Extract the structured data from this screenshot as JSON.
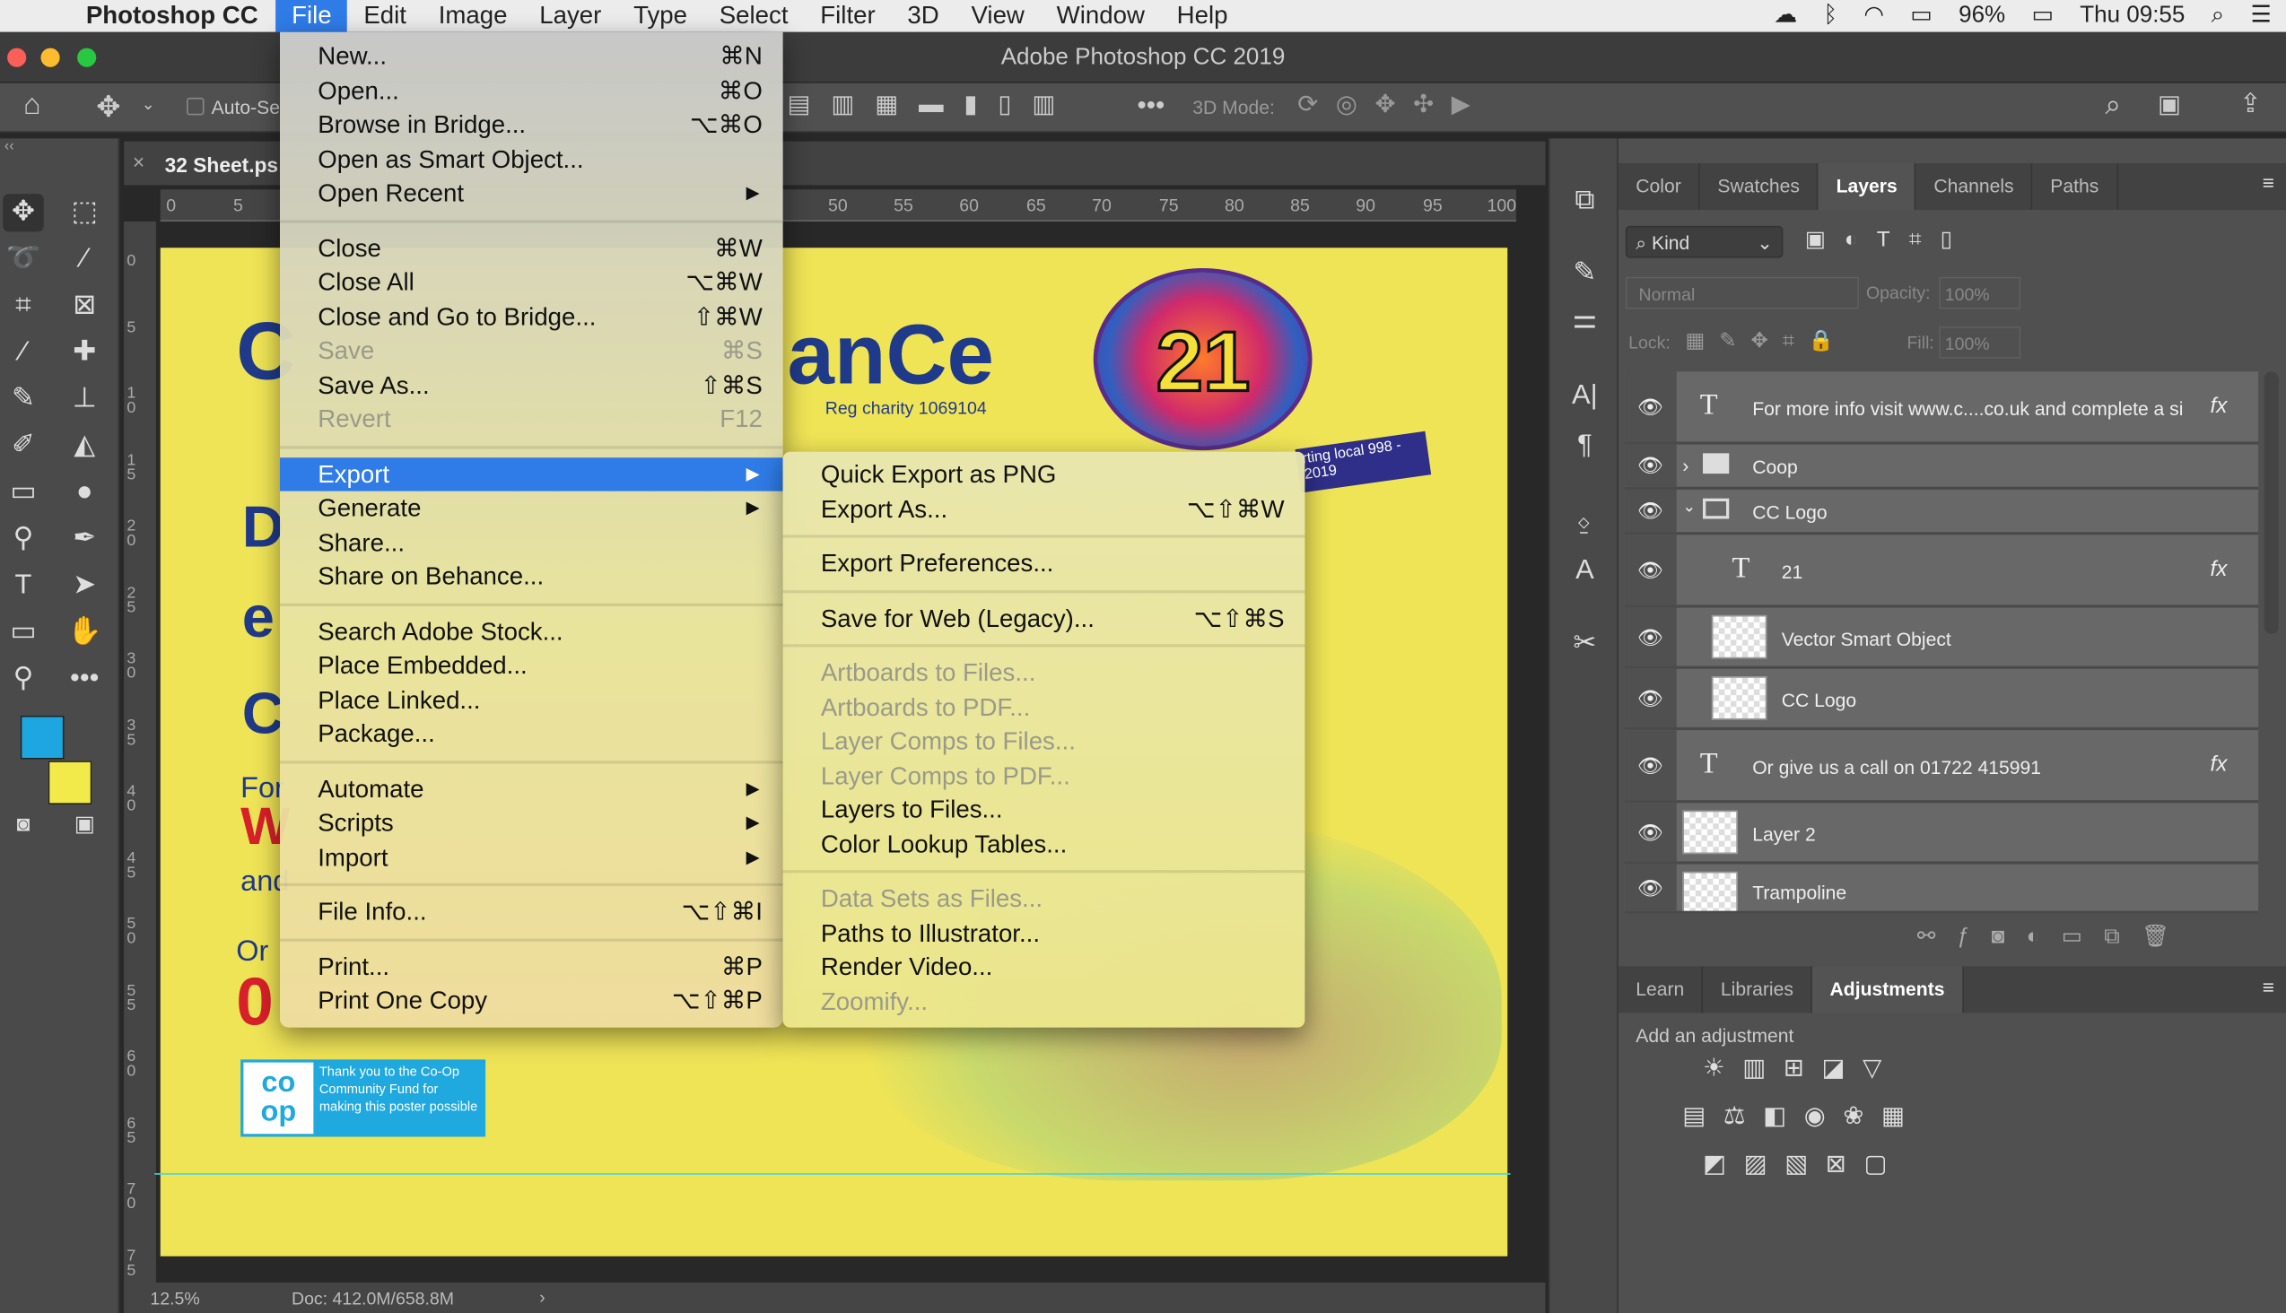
{
  "menubar": {
    "app": "Photoshop CC",
    "items": [
      "File",
      "Edit",
      "Image",
      "Layer",
      "Type",
      "Select",
      "Filter",
      "3D",
      "View",
      "Window",
      "Help"
    ],
    "battery": "96%",
    "clock": "Thu 09:55"
  },
  "window": {
    "title": "Adobe Photoshop CC 2019"
  },
  "options": {
    "auto_select": "Auto-Se",
    "mode_3d": "3D Mode:"
  },
  "document": {
    "tab": "32 Sheet.ps",
    "zoom": "12.5%",
    "doc_size": "Doc: 412.0M/658.8M",
    "ruler_h": [
      "0",
      "5",
      "50",
      "55",
      "60",
      "65",
      "70",
      "75",
      "80",
      "85",
      "90",
      "95",
      "100"
    ],
    "ruler_v": [
      "0",
      "5",
      "10",
      "15",
      "20",
      "25",
      "30",
      "35",
      "40",
      "45",
      "50",
      "55",
      "60",
      "65",
      "70",
      "75"
    ],
    "poster": {
      "title_fragment": "anCe",
      "charity": "Reg charity 1069104",
      "logo_number": "21",
      "banner": "rting local 998 - 2019",
      "coop_logo": "co op",
      "coop_text": "Thank you to the Co-Op Community Fund for making this poster possible",
      "left_letters": [
        "C",
        "D",
        "e",
        "C",
        "For",
        "W",
        "and",
        "Or",
        "0"
      ]
    }
  },
  "file_menu": {
    "groups": [
      [
        {
          "label": "New...",
          "shortcut": "⌘N"
        },
        {
          "label": "Open...",
          "shortcut": "⌘O"
        },
        {
          "label": "Browse in Bridge...",
          "shortcut": "⌥⌘O"
        },
        {
          "label": "Open as Smart Object...",
          "shortcut": ""
        },
        {
          "label": "Open Recent",
          "shortcut": "",
          "submenu": true
        }
      ],
      [
        {
          "label": "Close",
          "shortcut": "⌘W"
        },
        {
          "label": "Close All",
          "shortcut": "⌥⌘W"
        },
        {
          "label": "Close and Go to Bridge...",
          "shortcut": "⇧⌘W"
        },
        {
          "label": "Save",
          "shortcut": "⌘S",
          "disabled": true
        },
        {
          "label": "Save As...",
          "shortcut": "⇧⌘S"
        },
        {
          "label": "Revert",
          "shortcut": "F12",
          "disabled": true
        }
      ],
      [
        {
          "label": "Export",
          "shortcut": "",
          "submenu": true,
          "highlighted": true
        },
        {
          "label": "Generate",
          "shortcut": "",
          "submenu": true
        },
        {
          "label": "Share...",
          "shortcut": ""
        },
        {
          "label": "Share on Behance...",
          "shortcut": ""
        }
      ],
      [
        {
          "label": "Search Adobe Stock...",
          "shortcut": ""
        },
        {
          "label": "Place Embedded...",
          "shortcut": ""
        },
        {
          "label": "Place Linked...",
          "shortcut": ""
        },
        {
          "label": "Package...",
          "shortcut": ""
        }
      ],
      [
        {
          "label": "Automate",
          "shortcut": "",
          "submenu": true
        },
        {
          "label": "Scripts",
          "shortcut": "",
          "submenu": true
        },
        {
          "label": "Import",
          "shortcut": "",
          "submenu": true
        }
      ],
      [
        {
          "label": "File Info...",
          "shortcut": "⌥⇧⌘I"
        }
      ],
      [
        {
          "label": "Print...",
          "shortcut": "⌘P"
        },
        {
          "label": "Print One Copy",
          "shortcut": "⌥⇧⌘P"
        }
      ]
    ]
  },
  "export_menu": {
    "groups": [
      [
        {
          "label": "Quick Export as PNG",
          "shortcut": ""
        },
        {
          "label": "Export As...",
          "shortcut": "⌥⇧⌘W"
        }
      ],
      [
        {
          "label": "Export Preferences...",
          "shortcut": ""
        }
      ],
      [
        {
          "label": "Save for Web (Legacy)...",
          "shortcut": "⌥⇧⌘S"
        }
      ],
      [
        {
          "label": "Artboards to Files...",
          "disabled": true
        },
        {
          "label": "Artboards to PDF...",
          "disabled": true
        },
        {
          "label": "Layer Comps to Files...",
          "disabled": true
        },
        {
          "label": "Layer Comps to PDF...",
          "disabled": true
        },
        {
          "label": "Layers to Files..."
        },
        {
          "label": "Color Lookup Tables..."
        }
      ],
      [
        {
          "label": "Data Sets as Files...",
          "disabled": true
        },
        {
          "label": "Paths to Illustrator..."
        },
        {
          "label": "Render Video..."
        },
        {
          "label": "Zoomify...",
          "disabled": true
        }
      ]
    ]
  },
  "layers_panel": {
    "tabs": [
      "Color",
      "Swatches",
      "Layers",
      "Channels",
      "Paths"
    ],
    "active_tab": "Layers",
    "filter": "Kind",
    "blend_mode": "Normal",
    "opacity_label": "Opacity:",
    "opacity": "100%",
    "lock_label": "Lock:",
    "fill_label": "Fill:",
    "fill": "100%",
    "layers": [
      {
        "name": "For more info visit www.c....co.uk and complete a si",
        "kind": "text",
        "fx": "fx"
      },
      {
        "name": "Coop",
        "kind": "group-collapsed"
      },
      {
        "name": "CC Logo",
        "kind": "group-expanded"
      },
      {
        "name": "21",
        "kind": "text",
        "fx": "fx"
      },
      {
        "name": "Vector Smart Object",
        "kind": "smart"
      },
      {
        "name": "CC Logo",
        "kind": "pixel"
      },
      {
        "name": "Or give us a call on  01722 415991",
        "kind": "text",
        "fx": "fx"
      },
      {
        "name": "Layer 2",
        "kind": "pixel"
      },
      {
        "name": "Trampoline",
        "kind": "pixel"
      }
    ]
  },
  "adjustments_panel": {
    "tabs": [
      "Learn",
      "Libraries",
      "Adjustments"
    ],
    "active_tab": "Adjustments",
    "hint": "Add an adjustment"
  },
  "colors": {
    "foreground": "#1ea6e0",
    "background": "#f2ea4a",
    "poster": "#efe456",
    "highlight": "#2f7ce8"
  }
}
